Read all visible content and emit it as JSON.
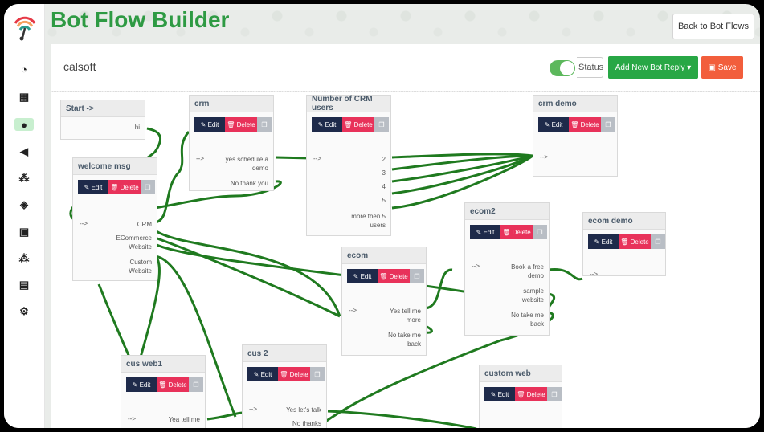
{
  "app": {
    "title": "Bot Flow Builder",
    "back_label": "Back to Bot Flows"
  },
  "bot": {
    "name": "calsoft",
    "status_label": "Status",
    "add_label": "Add New Bot Reply ▾",
    "save_label": "Save"
  },
  "sidebar": {
    "icons": [
      "dashboard-icon",
      "grid-icon",
      "chat-icon",
      "megaphone-icon",
      "users-icon",
      "layers-icon",
      "robot-icon",
      "team-icon",
      "id-card-icon",
      "settings-icon"
    ]
  },
  "buttons": {
    "edit": "Edit",
    "delete": "Delete"
  },
  "arrow": "-->",
  "nodes": {
    "start": {
      "title": "Start ->",
      "opts": [
        "hi"
      ]
    },
    "welcome": {
      "title": "welcome msg",
      "opts": [
        "CRM",
        "ECommerce Website",
        "Custom Website"
      ]
    },
    "crm": {
      "title": "crm",
      "opts": [
        "yes schedule a demo",
        "No thank you"
      ]
    },
    "crmusers": {
      "title": "Number of CRM users",
      "opts": [
        "2",
        "3",
        "4",
        "5",
        "more then 5 users"
      ]
    },
    "crmdemo": {
      "title": "crm demo"
    },
    "ecom": {
      "title": "ecom",
      "opts": [
        "Yes tell me more",
        "No take me back"
      ]
    },
    "ecom2": {
      "title": "ecom2",
      "opts": [
        "Book a free demo",
        "sample website",
        "No take me back"
      ]
    },
    "ecomdemo": {
      "title": "ecom demo"
    },
    "cusweb1": {
      "title": "cus web1",
      "opts": [
        "Yea tell me"
      ]
    },
    "cus2": {
      "title": "cus 2",
      "opts": [
        "Yes let's talk",
        "No thanks"
      ]
    },
    "customweb": {
      "title": "custom web"
    }
  }
}
